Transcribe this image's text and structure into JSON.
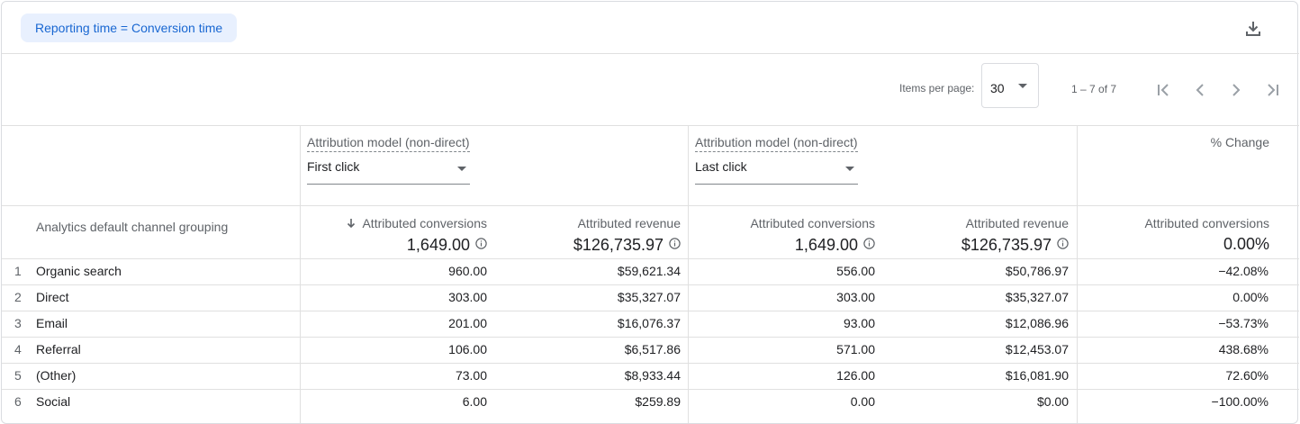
{
  "toolbar": {
    "chip_label": "Reporting time = Conversion time",
    "download_icon": "download-icon"
  },
  "pagination": {
    "items_per_page_label": "Items per page:",
    "items_per_page_value": "30",
    "range_label": "1 – 7 of 7"
  },
  "columns": {
    "model_a": {
      "label": "Attribution model (non-direct)",
      "value": "First click"
    },
    "model_b": {
      "label": "Attribution model (non-direct)",
      "value": "Last click"
    },
    "pct_change_header": "% Change",
    "dimension_header": "Analytics default channel grouping",
    "metrics": [
      {
        "label": "Attributed conversions",
        "total": "1,649.00",
        "sorted": true
      },
      {
        "label": "Attributed revenue",
        "total": "$126,735.97"
      },
      {
        "label": "Attributed conversions",
        "total": "1,649.00"
      },
      {
        "label": "Attributed revenue",
        "total": "$126,735.97"
      },
      {
        "label": "Attributed conversions",
        "total": "0.00%"
      }
    ]
  },
  "rows": [
    {
      "idx": "1",
      "channel": "Organic search",
      "a_conv": "960.00",
      "a_rev": "$59,621.34",
      "b_conv": "556.00",
      "b_rev": "$50,786.97",
      "pct": "−42.08%"
    },
    {
      "idx": "2",
      "channel": "Direct",
      "a_conv": "303.00",
      "a_rev": "$35,327.07",
      "b_conv": "303.00",
      "b_rev": "$35,327.07",
      "pct": "0.00%"
    },
    {
      "idx": "3",
      "channel": "Email",
      "a_conv": "201.00",
      "a_rev": "$16,076.37",
      "b_conv": "93.00",
      "b_rev": "$12,086.96",
      "pct": "−53.73%"
    },
    {
      "idx": "4",
      "channel": "Referral",
      "a_conv": "106.00",
      "a_rev": "$6,517.86",
      "b_conv": "571.00",
      "b_rev": "$12,453.07",
      "pct": "438.68%"
    },
    {
      "idx": "5",
      "channel": "(Other)",
      "a_conv": "73.00",
      "a_rev": "$8,933.44",
      "b_conv": "126.00",
      "b_rev": "$16,081.90",
      "pct": "72.60%"
    },
    {
      "idx": "6",
      "channel": "Social",
      "a_conv": "6.00",
      "a_rev": "$259.89",
      "b_conv": "0.00",
      "b_rev": "$0.00",
      "pct": "−100.00%"
    }
  ],
  "colors": {
    "accent": "#1967d2",
    "chip_bg": "#e8f0fe",
    "border": "#e0e0e0",
    "muted_text": "#5f6368"
  }
}
